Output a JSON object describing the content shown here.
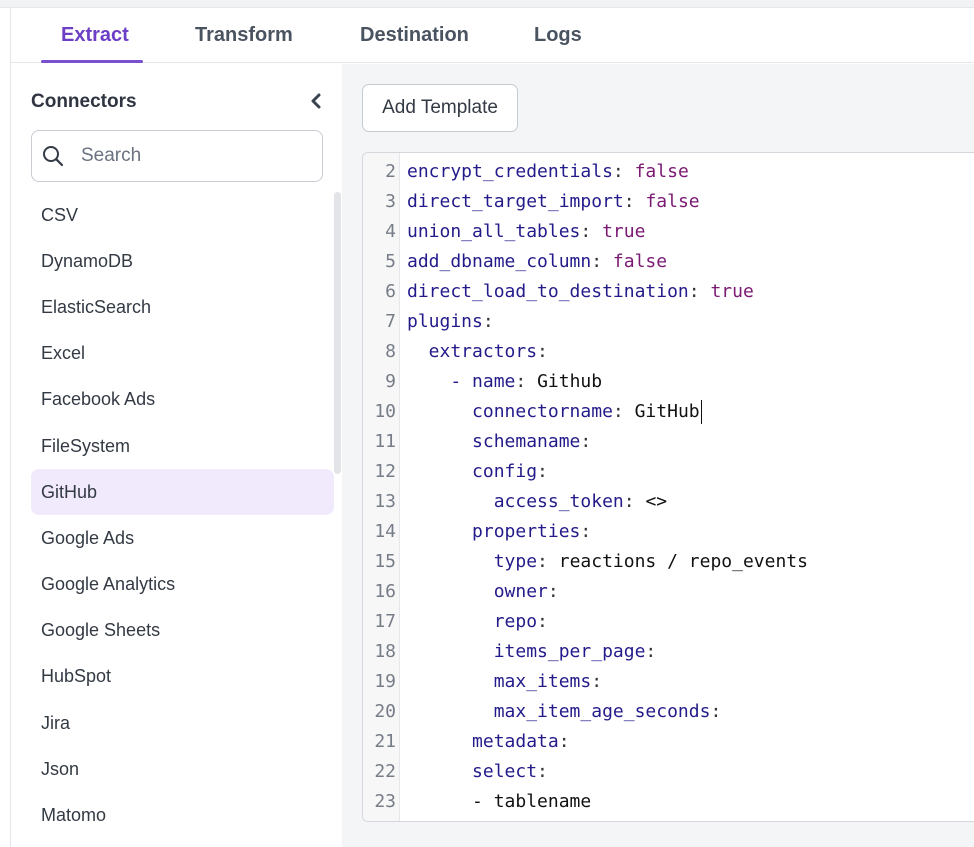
{
  "tabs": [
    {
      "label": "Extract",
      "active": true
    },
    {
      "label": "Transform",
      "active": false
    },
    {
      "label": "Destination",
      "active": false
    },
    {
      "label": "Logs",
      "active": false
    }
  ],
  "sidebar": {
    "title": "Connectors",
    "search_placeholder": "Search",
    "items": [
      "CSV",
      "DynamoDB",
      "ElasticSearch",
      "Excel",
      "Facebook Ads",
      "FileSystem",
      "GitHub",
      "Google Ads",
      "Google Analytics",
      "Google Sheets",
      "HubSpot",
      "Jira",
      "Json",
      "Matomo"
    ],
    "selected": "GitHub"
  },
  "main": {
    "add_template_label": "Add Template"
  },
  "editor": {
    "lines": [
      {
        "n": "2",
        "key": "encrypt_credentials",
        "val": "false",
        "vtype": "bool"
      },
      {
        "n": "3",
        "key": "direct_target_import",
        "val": "false",
        "vtype": "bool"
      },
      {
        "n": "4",
        "key": "union_all_tables",
        "val": "true",
        "vtype": "bool"
      },
      {
        "n": "5",
        "key": "add_dbname_column",
        "val": "false",
        "vtype": "bool"
      },
      {
        "n": "6",
        "key": "direct_load_to_destination",
        "val": "true",
        "vtype": "bool"
      },
      {
        "n": "7",
        "key": "plugins",
        "val": "",
        "vtype": "none"
      },
      {
        "n": "8",
        "key": "  extractors",
        "val": "",
        "vtype": "none"
      },
      {
        "n": "9",
        "key": "    - name",
        "val": "Github",
        "vtype": "str"
      },
      {
        "n": "10",
        "key": "      connectorname",
        "val": "GitHub",
        "vtype": "str",
        "cursor": true
      },
      {
        "n": "11",
        "key": "      schemaname",
        "val": "",
        "vtype": "none"
      },
      {
        "n": "12",
        "key": "      config",
        "val": "",
        "vtype": "none"
      },
      {
        "n": "13",
        "key": "        access_token",
        "val": "<>",
        "vtype": "str"
      },
      {
        "n": "14",
        "key": "      properties",
        "val": "",
        "vtype": "none"
      },
      {
        "n": "15",
        "key": "        type",
        "val": "reactions / repo_events",
        "vtype": "str"
      },
      {
        "n": "16",
        "key": "        owner",
        "val": "",
        "vtype": "none"
      },
      {
        "n": "17",
        "key": "        repo",
        "val": "",
        "vtype": "none"
      },
      {
        "n": "18",
        "key": "        items_per_page",
        "val": "",
        "vtype": "none"
      },
      {
        "n": "19",
        "key": "        max_items",
        "val": "",
        "vtype": "none"
      },
      {
        "n": "20",
        "key": "        max_item_age_seconds",
        "val": "",
        "vtype": "none"
      },
      {
        "n": "21",
        "key": "      metadata",
        "val": "",
        "vtype": "none"
      },
      {
        "n": "22",
        "key": "      select",
        "val": "",
        "vtype": "none"
      },
      {
        "n": "23",
        "key": "      - tablename",
        "val": "",
        "vtype": "plain"
      }
    ]
  },
  "colors": {
    "accent": "#6d3fc6",
    "selected_bg": "#f1e9fc",
    "yaml_key": "#231b8a",
    "yaml_bool": "#7a1a73"
  },
  "icons": {
    "collapse": "chevron-left-icon",
    "search": "search-icon"
  }
}
